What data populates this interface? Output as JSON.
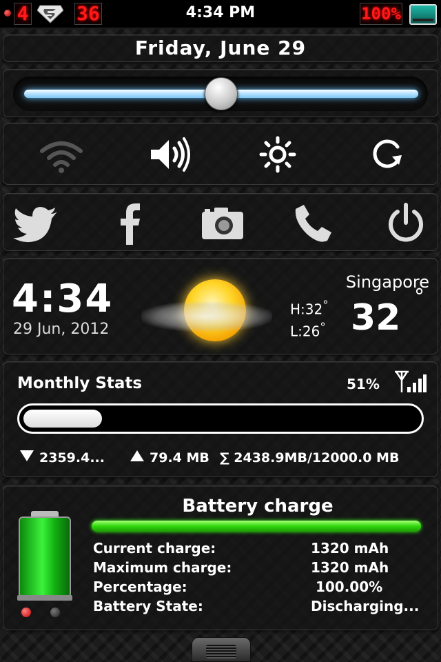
{
  "status_bar": {
    "led_digit_left": "4",
    "led_digit_middle": "36",
    "led_battery": "100%",
    "time": "4:34 PM"
  },
  "date_bar": {
    "label": "Friday, June 29"
  },
  "brightness_slider": {
    "level": 0.5
  },
  "toggles": [
    {
      "name": "wifi-icon",
      "state": "off"
    },
    {
      "name": "volume-icon",
      "state": "on"
    },
    {
      "name": "brightness-icon",
      "state": "on"
    },
    {
      "name": "rotation-lock-icon",
      "state": "on"
    }
  ],
  "apps": [
    "twitter-icon",
    "facebook-icon",
    "camera-icon",
    "phone-icon",
    "power-icon"
  ],
  "clock": {
    "time": "4:34",
    "date": "29 Jun, 2012"
  },
  "weather": {
    "city": "Singapore",
    "high_label": "H:",
    "high": "32",
    "low_label": "L:",
    "low": "26",
    "degree_symbol": "°",
    "current_temp": "32",
    "temp_unit_symbol": "°",
    "condition_icon": "sun-cloud-icon"
  },
  "monthly_stats": {
    "title": "Monthly Stats",
    "percent": "51%",
    "usage_fraction": 0.2,
    "download": "2359.4...",
    "upload": "79.4 MB",
    "total": "∑ 2438.9MB/12000.0 MB"
  },
  "battery": {
    "title": "Battery charge",
    "charge_fraction": 1.0,
    "rows": [
      {
        "label": "Current charge:",
        "value": "1320 mAh"
      },
      {
        "label": "Maximum charge:",
        "value": "1320 mAh"
      },
      {
        "label": "Percentage:",
        "value": " 100.00%"
      },
      {
        "label": "Battery State:",
        "value": "Discharging..."
      }
    ]
  },
  "colors": {
    "led_red": "#ff1a1a",
    "slider_glow": "#64bdf7",
    "battery_green": "#2fd80c"
  }
}
